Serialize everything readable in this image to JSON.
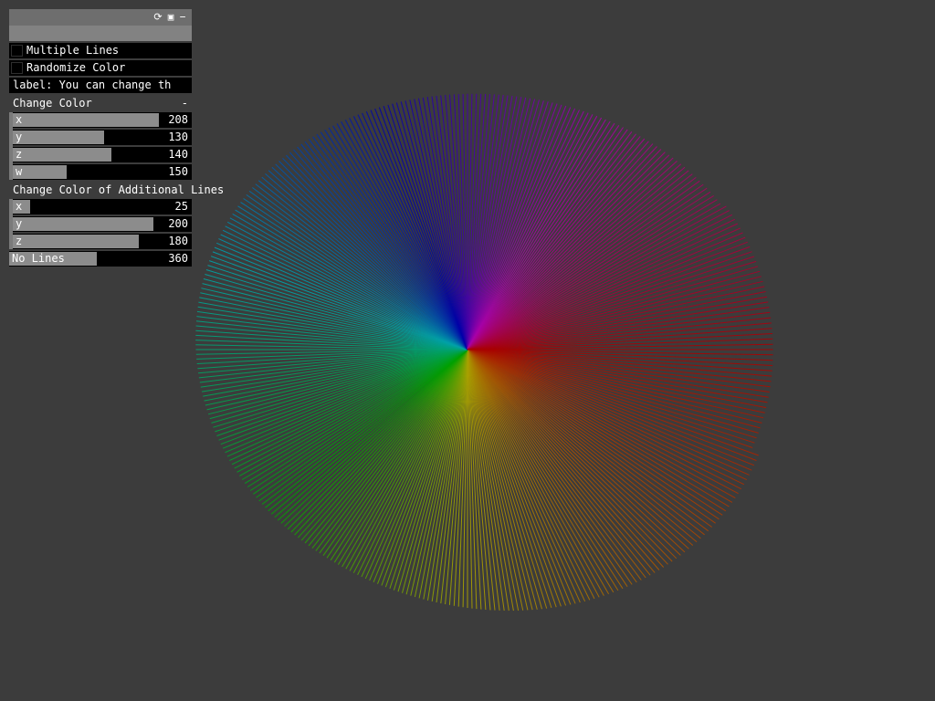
{
  "gui": {
    "header_icons": [
      "reload-icon",
      "save-icon",
      "minimize-icon"
    ],
    "toggles": [
      {
        "label": "Multiple Lines",
        "checked": false
      },
      {
        "label": "Randomize Color",
        "checked": false
      }
    ],
    "label_text": "label: You can change th",
    "color_group": {
      "title": "Change Color",
      "collapse_symbol": "-",
      "sliders": [
        {
          "key": "x",
          "value": "208",
          "fraction": 0.8157
        },
        {
          "key": "y",
          "value": "130",
          "fraction": 0.5098
        },
        {
          "key": "z",
          "value": "140",
          "fraction": 0.549
        },
        {
          "key": "w",
          "value": "150",
          "fraction": 0.3
        }
      ]
    },
    "additional_group": {
      "title": "Change Color of Additional Lines",
      "sliders": [
        {
          "key": "x",
          "value": "25",
          "fraction": 0.098
        },
        {
          "key": "y",
          "value": "200",
          "fraction": 0.784
        },
        {
          "key": "z",
          "value": "180",
          "fraction": 0.706
        }
      ]
    },
    "lines_slider": {
      "label": "No Lines",
      "value": "360",
      "fraction": 0.48
    }
  },
  "visual": {
    "type": "color-wheel-lines",
    "line_count": 360,
    "background": "#3c3c3c"
  }
}
